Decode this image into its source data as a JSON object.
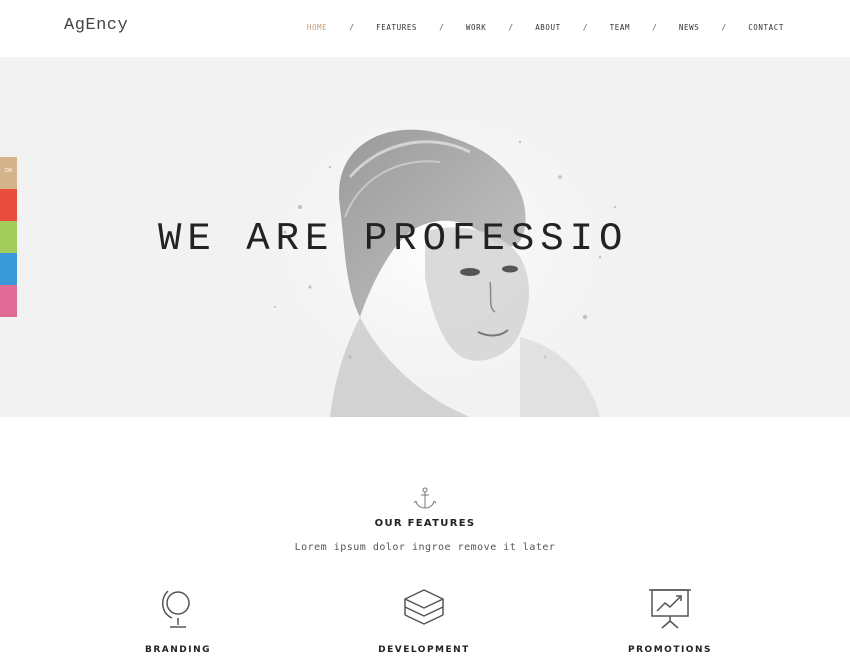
{
  "header": {
    "logo": "AgEncy",
    "nav": [
      {
        "label": "HOME",
        "active": true
      },
      {
        "label": "FEATURES",
        "active": false
      },
      {
        "label": "WORK",
        "active": false
      },
      {
        "label": "ABOUT",
        "active": false
      },
      {
        "label": "TEAM",
        "active": false
      },
      {
        "label": "NEWS",
        "active": false
      },
      {
        "label": "CONTACT",
        "active": false
      }
    ],
    "separator": "/",
    "accent_color": "#c8a07a"
  },
  "hero": {
    "title": "WE ARE PROFESSIO",
    "background": "#f2f2f2",
    "image": "woman-portrait-illustration"
  },
  "color_switcher": {
    "swatches": [
      {
        "color": "#d4b48a",
        "label": "OK"
      },
      {
        "color": "#e74c3c",
        "label": ""
      },
      {
        "color": "#a4cc5c",
        "label": ""
      },
      {
        "color": "#3a9ad9",
        "label": ""
      },
      {
        "color": "#e06b94",
        "label": ""
      }
    ]
  },
  "features": {
    "icon": "anchor-icon",
    "title": "OUR FEATURES",
    "subtitle": "Lorem ipsum dolor ingroe remove it later",
    "items": [
      {
        "icon": "globe-icon",
        "label": "BRANDING"
      },
      {
        "icon": "layers-icon",
        "label": "DEVELOPMENT"
      },
      {
        "icon": "presentation-chart-icon",
        "label": "PROMOTIONS"
      }
    ]
  }
}
